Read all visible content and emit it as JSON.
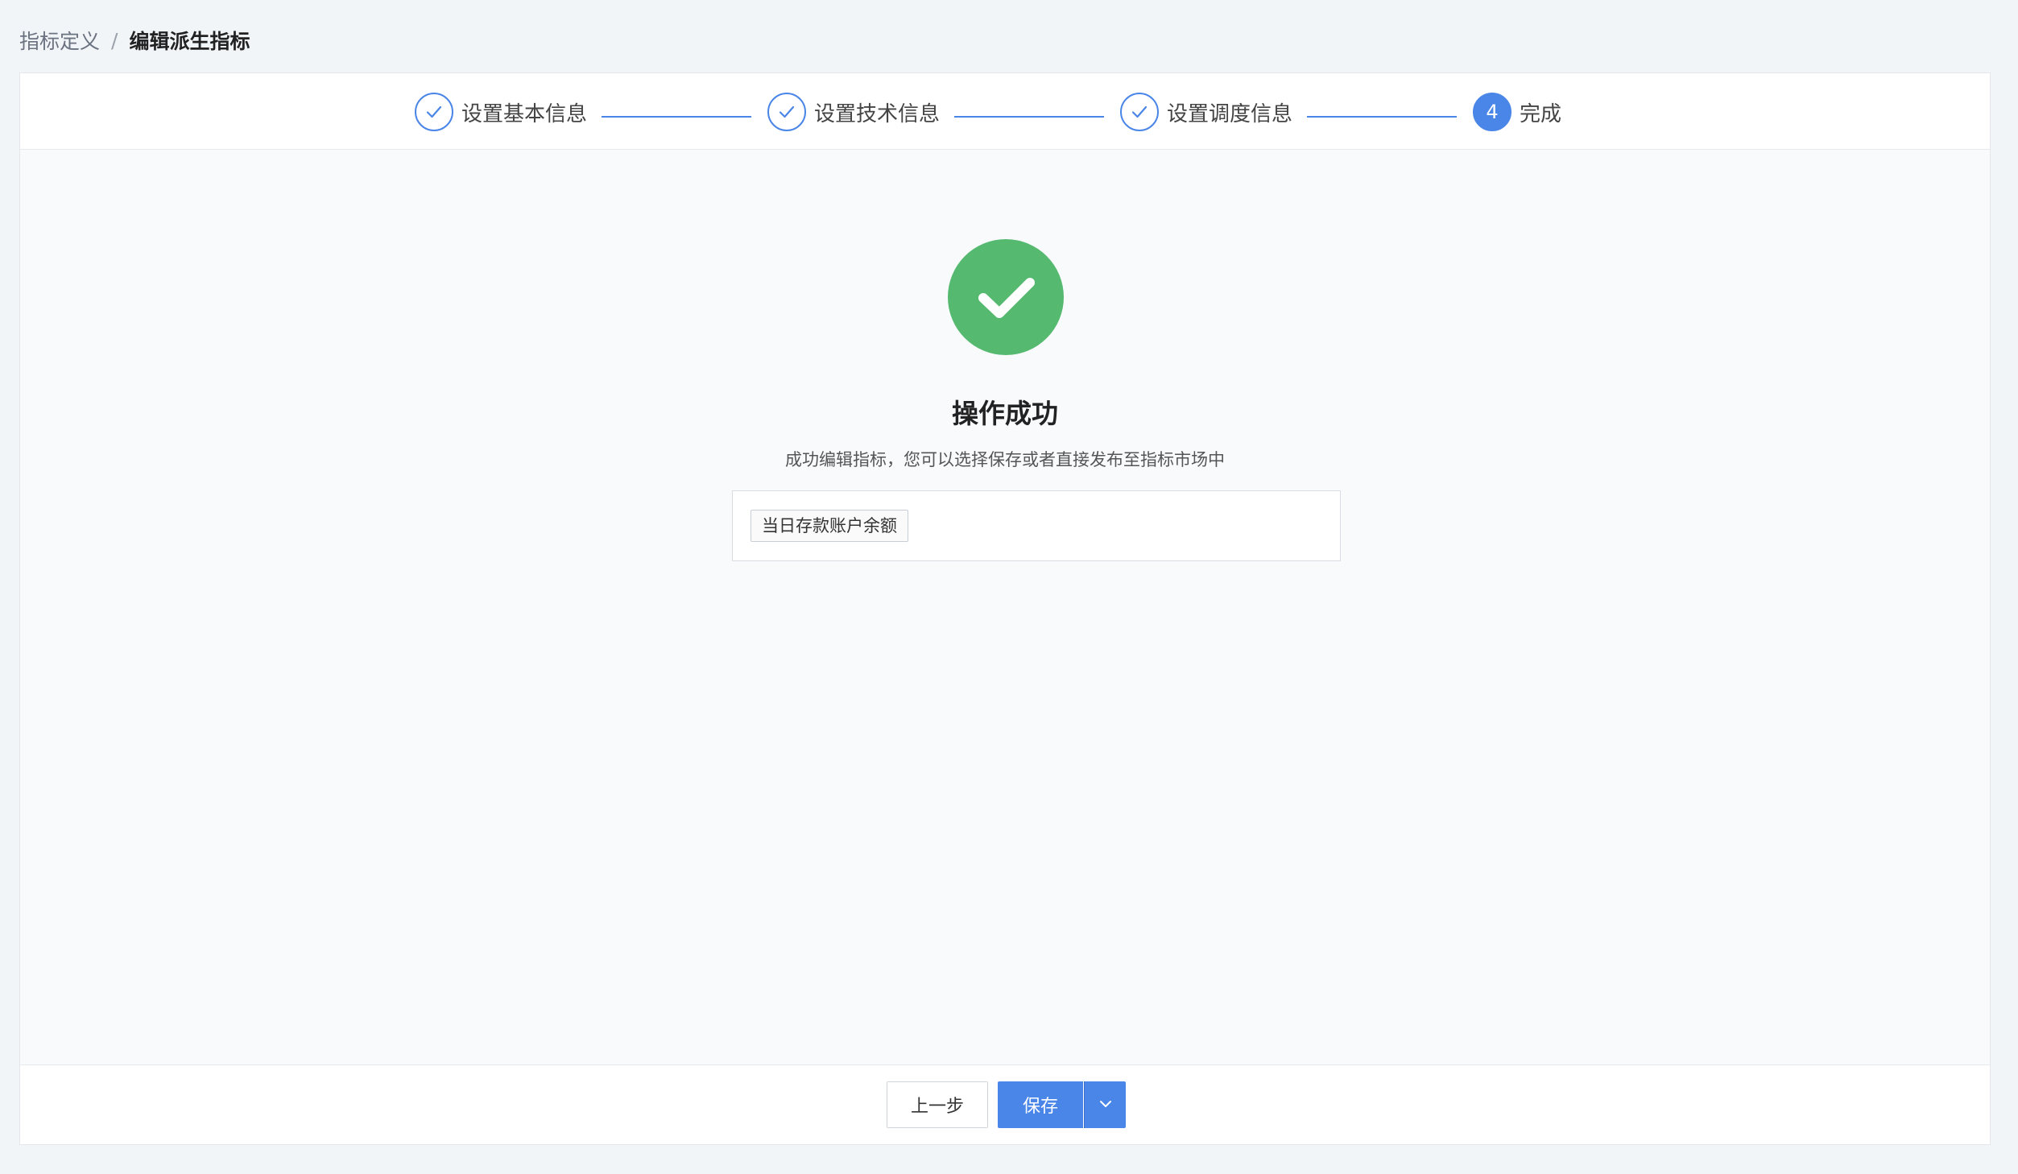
{
  "breadcrumb": {
    "parent": "指标定义",
    "separator": "/",
    "current": "编辑派生指标"
  },
  "steps": [
    {
      "label": "设置基本信息",
      "status": "done",
      "icon": "check-icon"
    },
    {
      "label": "设置技术信息",
      "status": "done",
      "icon": "check-icon"
    },
    {
      "label": "设置调度信息",
      "status": "done",
      "icon": "check-icon"
    },
    {
      "label": "完成",
      "status": "active",
      "number": "4"
    }
  ],
  "result": {
    "icon": "success-check-icon",
    "title": "操作成功",
    "description": "成功编辑指标，您可以选择保存或者直接发布至指标市场中",
    "tag": "当日存款账户余额"
  },
  "footer": {
    "prev_label": "上一步",
    "save_label": "保存",
    "dropdown_icon": "chevron-down-icon"
  },
  "colors": {
    "primary": "#4a86e8",
    "success": "#55b96f",
    "background": "#f2f5f8"
  }
}
